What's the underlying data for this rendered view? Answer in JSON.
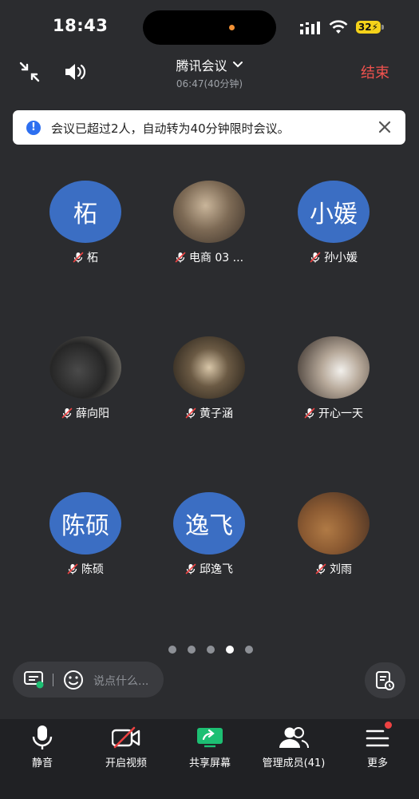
{
  "status_bar": {
    "time": "18:43",
    "battery": "32"
  },
  "header": {
    "title": "腾讯会议",
    "subtitle": "06:47(40分钟)",
    "end_label": "结束"
  },
  "banner": {
    "text": "会议已超过2人，自动转为40分钟限时会议。"
  },
  "participants": [
    {
      "name": "柘",
      "avatar_text": "柘",
      "avatar_type": "text"
    },
    {
      "name": "电商 03 ...",
      "avatar_type": "photo"
    },
    {
      "name": "孙小媛",
      "avatar_text": "小媛",
      "avatar_type": "text"
    },
    {
      "name": "薛向阳",
      "avatar_type": "photo"
    },
    {
      "name": "黄子涵",
      "avatar_type": "photo"
    },
    {
      "name": "开心一天",
      "avatar_type": "photo"
    },
    {
      "name": "陈硕",
      "avatar_text": "陈硕",
      "avatar_type": "text"
    },
    {
      "name": "邱逸飞",
      "avatar_text": "逸飞",
      "avatar_type": "text"
    },
    {
      "name": "刘雨",
      "avatar_type": "photo"
    }
  ],
  "pagination": {
    "total": 5,
    "current": 4
  },
  "chat": {
    "placeholder": "说点什么..."
  },
  "toolbar": {
    "mute": "静音",
    "video": "开启视频",
    "share": "共享屏幕",
    "members": "管理成员(41)",
    "more": "更多"
  },
  "colors": {
    "accent_red": "#f0524e",
    "avatar_blue": "#3b6ec3",
    "share_green": "#1dbf73"
  },
  "icons": [
    "minimize-icon",
    "speaker-icon",
    "chevron-down-icon",
    "info-icon",
    "close-icon",
    "mic-off-icon",
    "caption-icon",
    "emoji-icon",
    "notes-icon",
    "mic-icon",
    "video-off-icon",
    "share-screen-icon",
    "members-icon",
    "more-icon"
  ]
}
